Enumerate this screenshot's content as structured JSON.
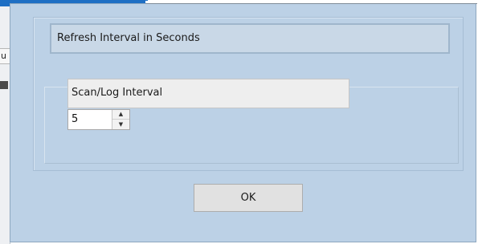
{
  "background_window": {
    "tab_fragment": "u"
  },
  "dialog": {
    "group_title": "Refresh Interval in Seconds",
    "field": {
      "label": "Scan/Log Interval",
      "value": "5",
      "spin_up_icon": "spin-up-arrow",
      "spin_down_icon": "spin-down-arrow"
    },
    "ok_label": "OK"
  },
  "colors": {
    "dialog_background": "#bcd1e6",
    "title_bar_accent": "#1e6fc4"
  }
}
